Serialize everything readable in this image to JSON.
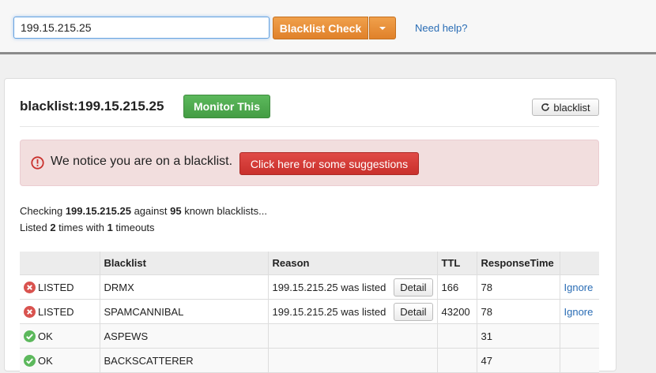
{
  "topbar": {
    "search_value": "199.15.215.25",
    "check_label": "Blacklist Check",
    "help_label": "Need help?"
  },
  "result": {
    "title": "blacklist:199.15.215.25",
    "monitor_label": "Monitor This",
    "refresh_label": "blacklist",
    "alert_text": "We notice you are on a blacklist.",
    "suggest_label": "Click here for some suggestions"
  },
  "summary": {
    "line1": {
      "pre": "Checking ",
      "ip": "199.15.215.25",
      "mid": " against ",
      "count": "95",
      "post": " known blacklists..."
    },
    "line2": {
      "pre": "Listed ",
      "listed": "2",
      "mid": " times with ",
      "timeouts": "1",
      "post": " timeouts"
    }
  },
  "table": {
    "headers": [
      "",
      "Blacklist",
      "Reason",
      "TTL",
      "ResponseTime",
      ""
    ],
    "rows": [
      {
        "status": "LISTED",
        "blacklist": "DRMX",
        "reason": "199.15.215.25 was listed",
        "detail": "Detail",
        "ttl": "166",
        "response": "78",
        "action": "Ignore"
      },
      {
        "status": "LISTED",
        "blacklist": "SPAMCANNIBAL",
        "reason": "199.15.215.25 was listed",
        "detail": "Detail",
        "ttl": "43200",
        "response": "78",
        "action": "Ignore"
      },
      {
        "status": "OK",
        "blacklist": "ASPEWS",
        "reason": "",
        "detail": "",
        "ttl": "",
        "response": "31",
        "action": ""
      },
      {
        "status": "OK",
        "blacklist": "BACKSCATTERER",
        "reason": "",
        "detail": "",
        "ttl": "",
        "response": "47",
        "action": ""
      }
    ]
  },
  "colors": {
    "accent_orange": "#e8902f",
    "monitor_green": "#4cae4c",
    "alert_bg": "#f2dede",
    "danger_red": "#d9534f",
    "ok_green": "#5cb85c",
    "link_blue": "#2a6db5"
  },
  "icons": {
    "caret": "chevron-down-icon",
    "refresh": "refresh-icon",
    "alert": "exclamation-circle-icon",
    "listed": "x-circle-icon",
    "ok": "check-circle-icon"
  }
}
